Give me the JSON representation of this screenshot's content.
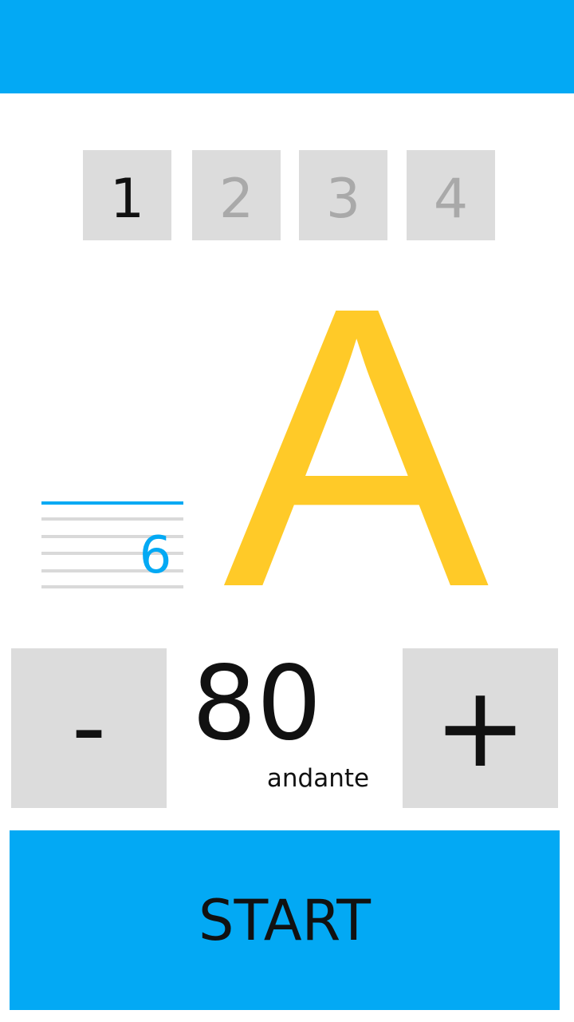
{
  "colors": {
    "accent": "#03a9f4",
    "note": "#ffca28",
    "tile": "#dcdcdc",
    "inactive_text": "#a9a9a9"
  },
  "beats": [
    {
      "label": "1",
      "active": true
    },
    {
      "label": "2",
      "active": false
    },
    {
      "label": "3",
      "active": false
    },
    {
      "label": "4",
      "active": false
    }
  ],
  "tuner": {
    "note": "A",
    "string_number": "6"
  },
  "tempo": {
    "decrease_label": "-",
    "increase_label": "+",
    "bpm": "80",
    "marking": "andante"
  },
  "start_label": "START"
}
